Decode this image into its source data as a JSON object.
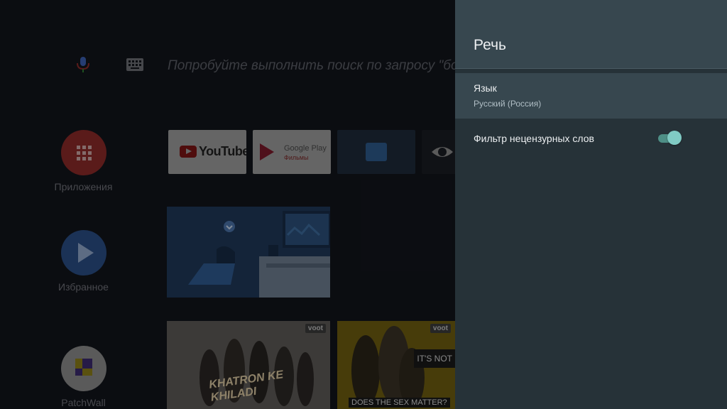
{
  "launcher": {
    "search_hint": "Попробуйте выполнить поиск по запросу \"боевики\"",
    "nav": [
      {
        "label": "Приложения"
      },
      {
        "label": "Избранное"
      },
      {
        "label": "PatchWall"
      }
    ],
    "apps_row": {
      "youtube": "YouTube",
      "google_play_line1": "Google Play",
      "google_play_line2": "Фильмы"
    },
    "cards": {
      "card1_badge": "voot",
      "card1_title": "KHATRON KE KHILADI",
      "card2_badge": "voot",
      "card2_tag": "IT'S NOT",
      "card2_caption": "DOES THE SEX MATTER?"
    }
  },
  "panel": {
    "title": "Речь",
    "language": {
      "label": "Язык",
      "value": "Русский (Россия)"
    },
    "filter": {
      "label": "Фильтр нецензурных слов",
      "enabled": true
    }
  },
  "colors": {
    "panel_bg": "#263238",
    "panel_header": "#37474f",
    "accent": "#80cbc4"
  }
}
